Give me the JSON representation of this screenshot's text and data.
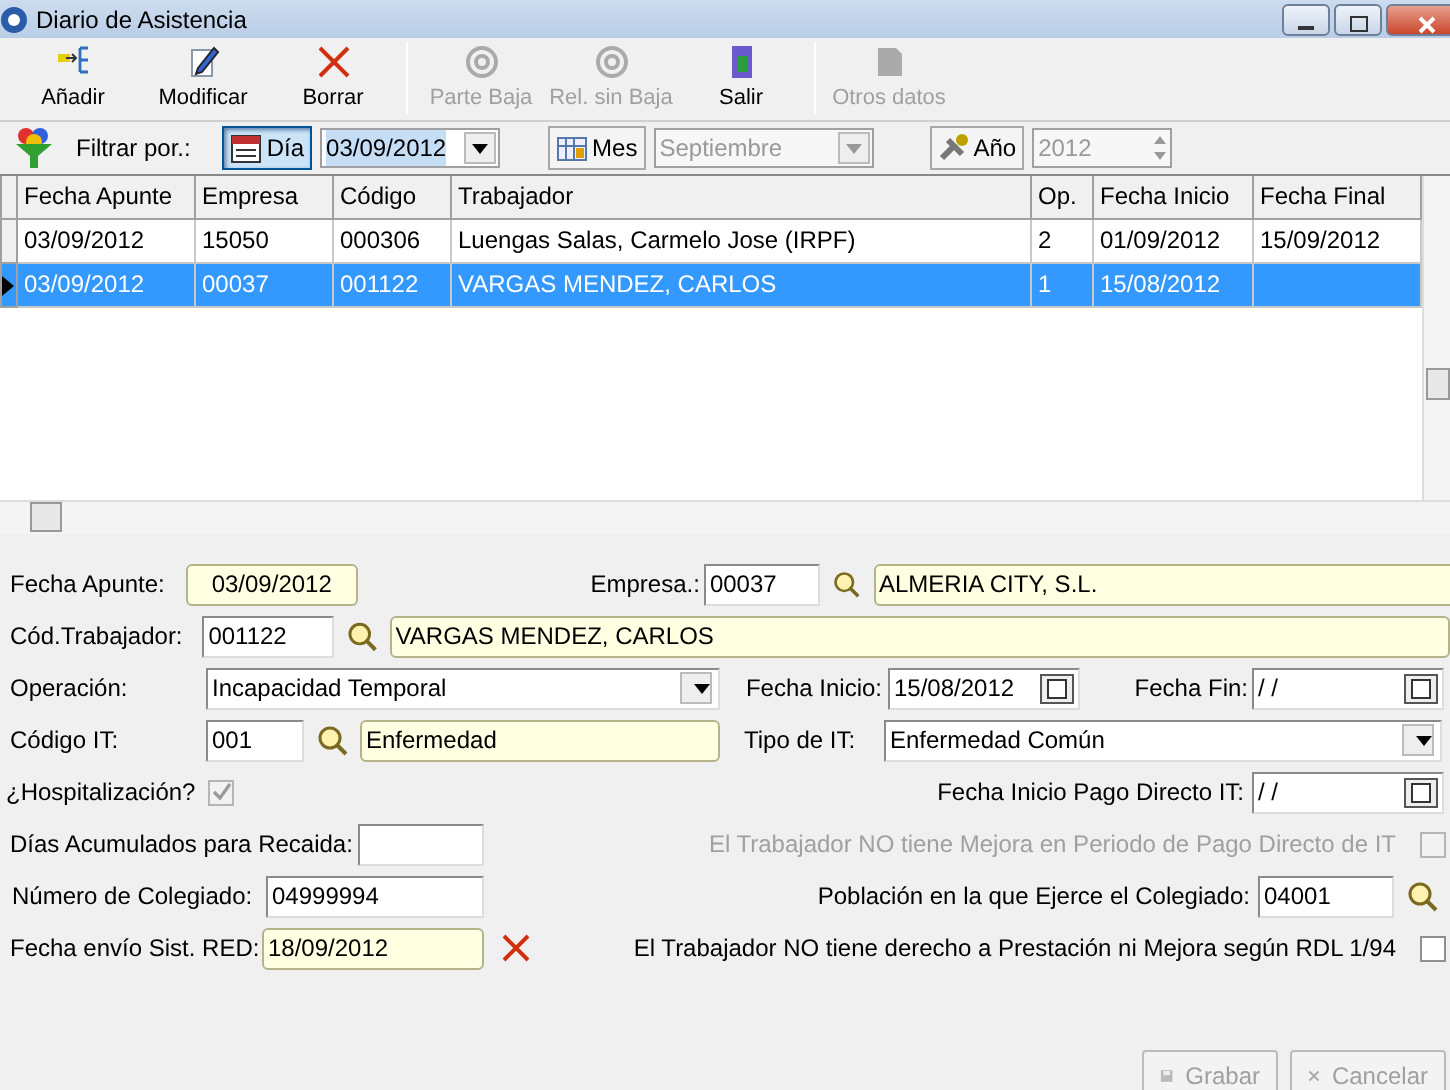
{
  "window": {
    "title": "Diario de Asistencia"
  },
  "toolbar": [
    {
      "kind": "add",
      "label": "Añadir",
      "disabled": false
    },
    {
      "kind": "edit",
      "label": "Modificar",
      "disabled": false
    },
    {
      "kind": "delete",
      "label": "Borrar",
      "disabled": false
    },
    {
      "kind": "at",
      "label": "Parte Baja",
      "disabled": true,
      "sep_before": true
    },
    {
      "kind": "at",
      "label": "Rel. sin Baja",
      "disabled": true
    },
    {
      "kind": "exit",
      "label": "Salir",
      "disabled": false
    },
    {
      "kind": "doc",
      "label": "Otros datos",
      "disabled": true,
      "sep_before": true
    }
  ],
  "filter": {
    "label": "Filtrar por.:",
    "modes": [
      {
        "kind": "day",
        "label": "Día",
        "selected": true,
        "value": "03/09/2012"
      },
      {
        "kind": "month",
        "label": "Mes",
        "selected": false,
        "value": "Septiembre"
      },
      {
        "kind": "year",
        "label": "Año",
        "selected": false,
        "value": "2012"
      }
    ]
  },
  "table": {
    "columns": [
      "Fecha Apunte",
      "Empresa",
      "Código",
      "Trabajador",
      "Op.",
      "Fecha Inicio",
      "Fecha Final"
    ],
    "rows": [
      {
        "selected": false,
        "cells": [
          "03/09/2012",
          "15050",
          "000306",
          "Luengas Salas, Carmelo Jose (IRPF)",
          "2",
          "01/09/2012",
          "15/09/2012"
        ]
      },
      {
        "selected": true,
        "cells": [
          "03/09/2012",
          "00037",
          "001122",
          "VARGAS MENDEZ, CARLOS",
          "1",
          "15/08/2012",
          ""
        ]
      }
    ]
  },
  "form": {
    "fecha_apunte": {
      "label": "Fecha Apunte:",
      "value": "03/09/2012"
    },
    "empresa": {
      "label": "Empresa.:",
      "code": "00037",
      "name": "ALMERIA CITY, S.L."
    },
    "cod_trabajador": {
      "label": "Cód.Trabajador:",
      "code": "001122",
      "name": "VARGAS MENDEZ, CARLOS"
    },
    "operacion": {
      "label": "Operación:",
      "value": "Incapacidad Temporal"
    },
    "fecha_inicio": {
      "label": "Fecha Inicio:",
      "value": "15/08/2012"
    },
    "fecha_fin": {
      "label": "Fecha Fin:",
      "value": " /  /"
    },
    "codigo_it": {
      "label": "Código IT:",
      "code": "001",
      "name": "Enfermedad"
    },
    "tipo_it": {
      "label": "Tipo de IT:",
      "value": "Enfermedad Común"
    },
    "hospitalizacion": {
      "label": "¿Hospitalización?",
      "checked": true,
      "disabled": true
    },
    "fecha_inicio_pago": {
      "label": "Fecha Inicio Pago Directo IT:",
      "value": " /  /"
    },
    "dias_acumulados": {
      "label": "Días Acumulados para Recaida:"
    },
    "sin_mejora": {
      "label": "El Trabajador NO tiene Mejora en Periodo de Pago Directo de IT",
      "checked": false,
      "disabled": true
    },
    "num_colegiado": {
      "label": "Número de Colegiado:",
      "value": "04999994"
    },
    "poblacion": {
      "label": "Población en la que Ejerce el Colegiado:",
      "value": "04001"
    },
    "fecha_envio": {
      "label": "Fecha envío Sist. RED:",
      "value": "18/09/2012"
    },
    "sin_prestacion": {
      "label": "El Trabajador NO tiene derecho a Prestación ni Mejora según RDL 1/94",
      "checked": false,
      "disabled": false
    }
  },
  "buttons": [
    {
      "kind": "save",
      "label": "Grabar",
      "disabled": true
    },
    {
      "kind": "cancel",
      "label": "Cancelar",
      "disabled": true
    }
  ]
}
